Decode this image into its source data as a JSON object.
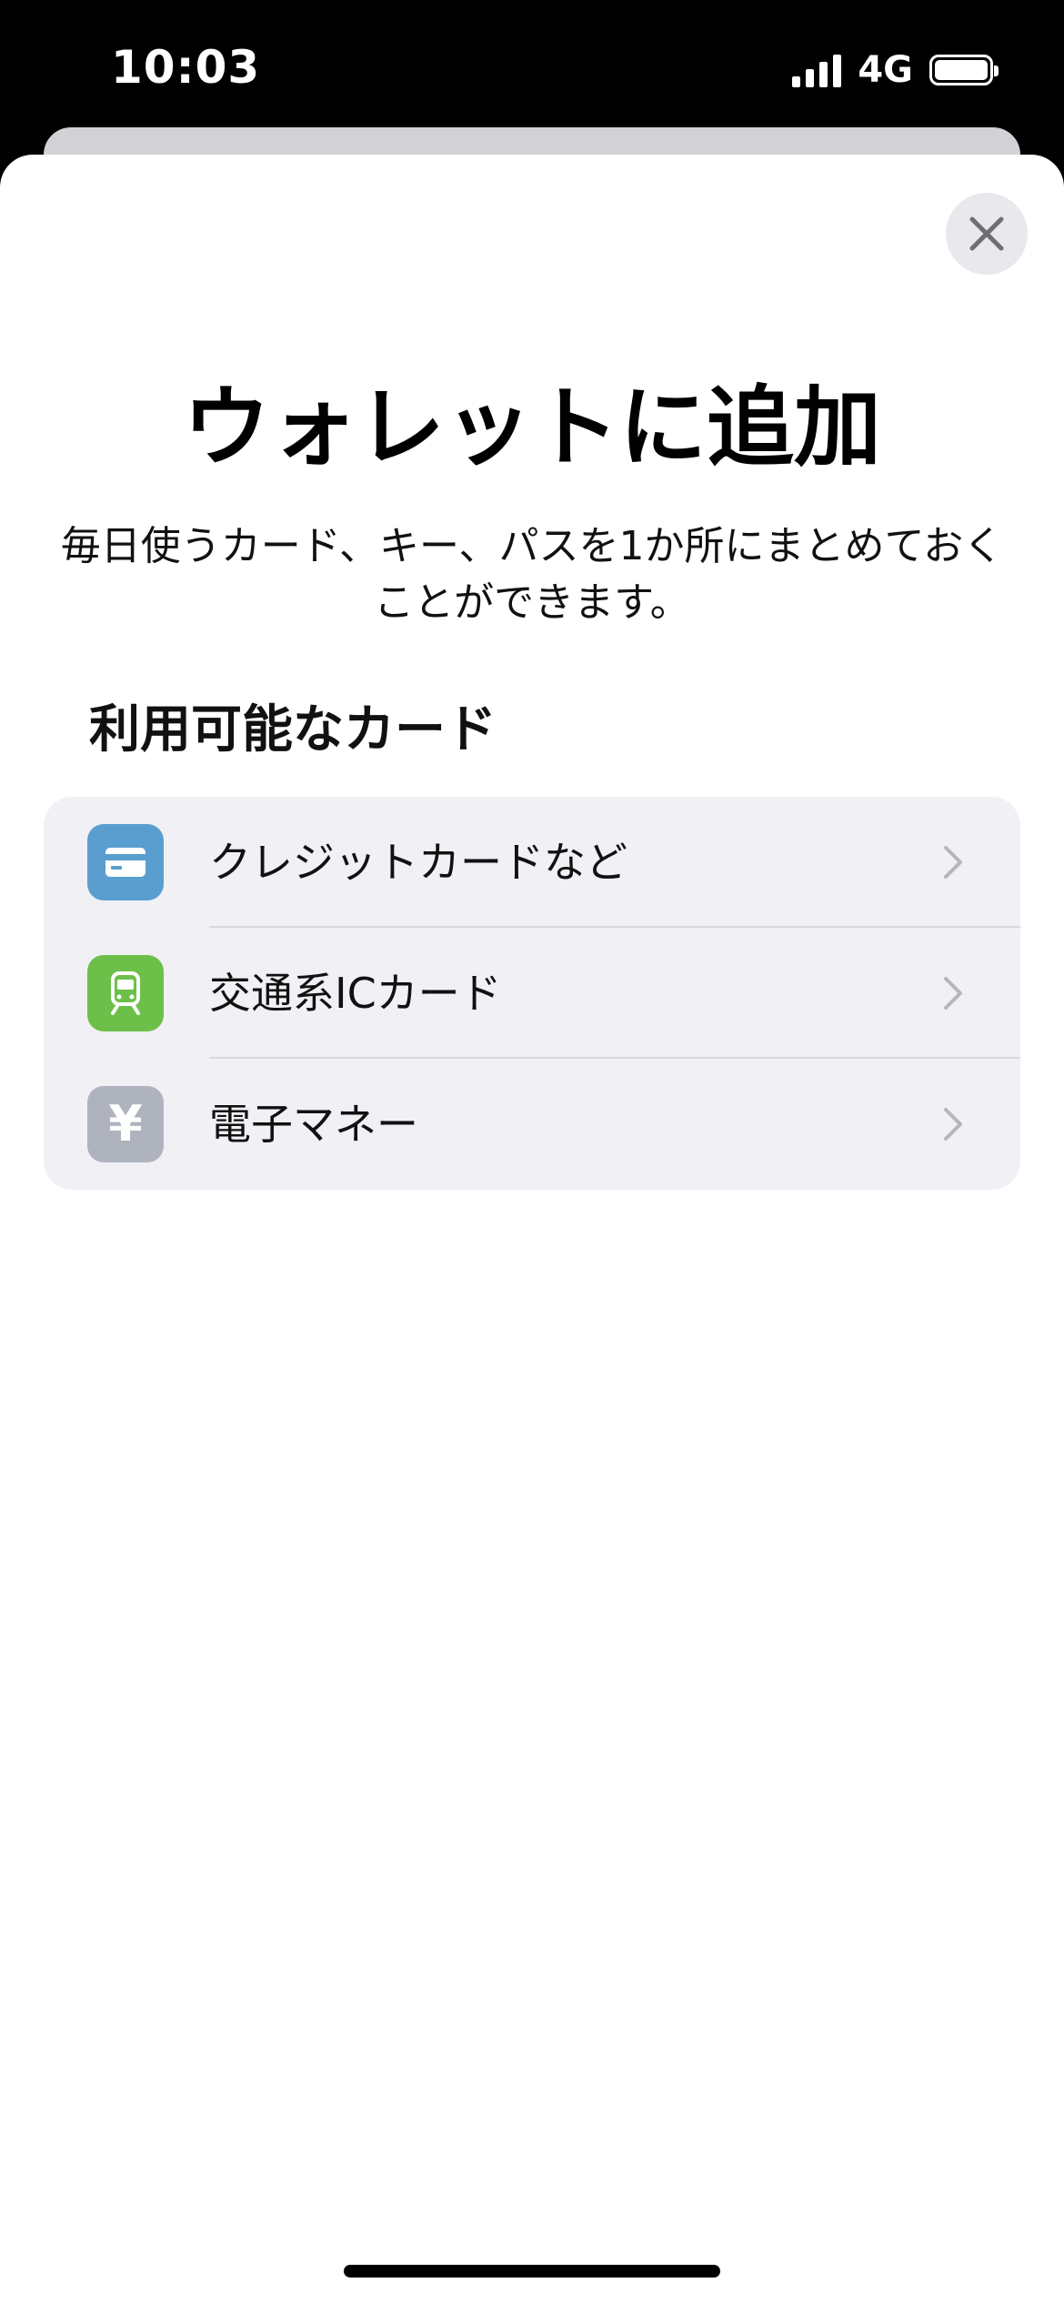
{
  "status_bar": {
    "time": "10:03",
    "network": "4G",
    "signal_bars": 4,
    "battery_level": 1.0
  },
  "sheet": {
    "title": "ウォレットに追加",
    "subtitle": "毎日使うカード、キー、パスを1か所にまとめておくことができます。",
    "section_title": "利用可能なカード",
    "items": [
      {
        "label": "クレジットカードなど",
        "icon": "credit-card-icon",
        "icon_color": "#5a9ed0"
      },
      {
        "label": "交通系ICカード",
        "icon": "train-icon",
        "icon_color": "#6cc04a"
      },
      {
        "label": "電子マネー",
        "icon": "yen-icon",
        "icon_color": "#aeb3bd",
        "icon_glyph": "¥"
      }
    ]
  },
  "colors": {
    "sheet_background": "#ffffff",
    "list_background": "#f0f0f5",
    "chevron": "#b5b5ba"
  }
}
